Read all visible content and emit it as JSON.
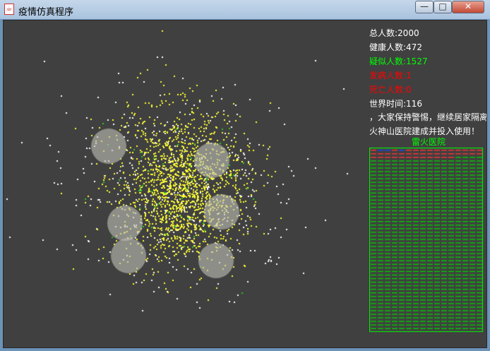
{
  "window": {
    "title": "疫情仿真程序",
    "app_icon_glyph": "☕",
    "minimize_glyph": "—",
    "maximize_glyph": "□",
    "close_glyph": "✕"
  },
  "stats": {
    "total_label": "总人数:2000",
    "healthy_label": "健康人数:472",
    "suspected_label": "疑似人数:1527",
    "sick_label": "发病人数:1",
    "dead_label": "死亡人数:0",
    "time_label": "世界时间:116"
  },
  "notices": {
    "line1": "，大家保持警惕，继续居家隔离",
    "line2": "火神山医院建成并投入使用！"
  },
  "hospital": {
    "name": "雷火医院",
    "beds_occupied_red_rows": 2,
    "beds_occupied_red_partial": 18,
    "blue_beds": [
      1,
      2,
      4
    ]
  },
  "colors": {
    "background": "#404040",
    "healthy": "#ffffff",
    "suspected": "#ffff33",
    "sick": "#22cc22",
    "stat_white": "#ffffff",
    "stat_green": "#00ff00",
    "stat_red": "#ff0000",
    "hospital_frame": "#00ff00",
    "bed_empty": "#00cc00",
    "bed_occupied": "#ff3333",
    "isolation_zone": "#a8a8a0"
  },
  "counts": {
    "healthy": 472,
    "suspected": 1527,
    "sick": 1
  }
}
